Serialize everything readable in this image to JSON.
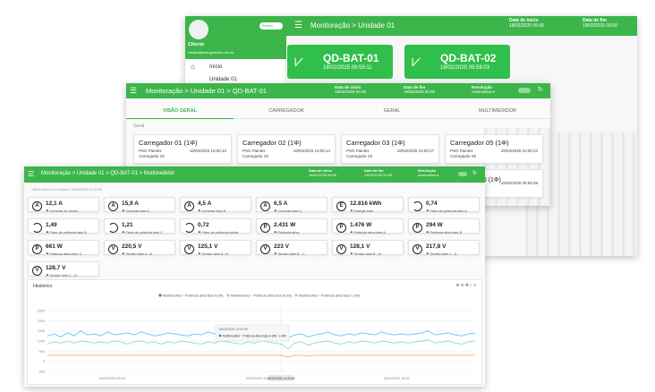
{
  "colors": {
    "brand": "#3cb54a",
    "card": "#2fbf4a",
    "current_a": "#2f7fd6",
    "power_a": "#56c8ea",
    "power_b": "#8adfb0",
    "power_c": "#f2b37a"
  },
  "win1": {
    "sidebar": {
      "user_name": "Cliente",
      "user_email": "cliente@energytrader.com.br",
      "switch_label": "Switch",
      "items": [
        {
          "label": "Início"
        },
        {
          "label": "Unidade 01"
        }
      ]
    },
    "header": {
      "title": "Monitoração > Unidade 01",
      "date_start_label": "Data de início",
      "date_start": "18/02/2025 06:00",
      "date_end_label": "Data de fim",
      "date_end": "19/02/2025 00:00"
    },
    "cards": [
      {
        "name": "QD-BAT-01",
        "date": "18/02/2025 09:59:11"
      },
      {
        "name": "QD-BAT-02",
        "date": "18/02/2025 09:59:03"
      }
    ]
  },
  "win2": {
    "header": {
      "title": "Monitoração > Unidade 01 > QD-BAT-01",
      "date_start_label": "Data de início",
      "date_start": "18/02/2025 06:00",
      "date_end_label": "Data de fim",
      "date_end": "19/02/2025 00:00",
      "resolution_label": "Resolução",
      "resolution": "Automática"
    },
    "tabs": [
      {
        "label": "VISÃO GERAL"
      },
      {
        "label": "CARREGADOR"
      },
      {
        "label": "GERAL"
      },
      {
        "label": "MULTIMEDIDOR"
      }
    ],
    "section_label": "Geral",
    "chargers": [
      {
        "title": "Carregador 01 (1Φ)",
        "line1": "PSO Painéis",
        "line2": "Carregador 01",
        "date": "18/02/2025 10:00:12"
      },
      {
        "title": "Carregador 02 (1Φ)",
        "line1": "PSO Painéis",
        "line2": "Carregador 02",
        "date": "18/02/2025 10:00:14"
      },
      {
        "title": "Carregador 03 (1Φ)",
        "line1": "PSO Painéis",
        "line2": "Carregador 03",
        "date": "18/02/2025 10:00:17"
      },
      {
        "title": "Carregador 05 (1Φ)",
        "line1": "PSO Painéis",
        "line2": "Carregador 05",
        "date": "18/02/2025 10:00:23"
      }
    ],
    "extra": {
      "title": "10 (1Φ)",
      "date": "18/02/2025 09:59:38"
    }
  },
  "win3": {
    "header": {
      "title": "Monitoração > Unidade 01 > QD-BAT-01 > Multimedidor",
      "date_start_label": "Data de início",
      "date_start": "18/02/2025 06:00",
      "date_end_label": "Data de fim",
      "date_end": "19/02/2025 00:00",
      "resolution_label": "Resolução",
      "resolution": "Automática"
    },
    "last_update": "Última leitura do medidor: 18/02/2025 11:02:00",
    "metrics": [
      {
        "icon": "A",
        "value": "12,1 A",
        "label": "Corrente de neutro"
      },
      {
        "icon": "A",
        "value": "15,9 A",
        "label": "Corrente fase A"
      },
      {
        "icon": "A",
        "value": "4,5 A",
        "label": "Corrente fase B"
      },
      {
        "icon": "A",
        "value": "6,5 A",
        "label": "Corrente fase C"
      },
      {
        "icon": "E",
        "value": "12.816 kWh",
        "label": "Energia total"
      },
      {
        "icon": "pf",
        "value": "0,74",
        "label": "Fator de potência fase A"
      },
      {
        "icon": "pf",
        "value": "1,49",
        "label": "Fator de potência fase B"
      },
      {
        "icon": "pf",
        "value": "1,21",
        "label": "Fator de potência fase C"
      },
      {
        "icon": "pf",
        "value": "0,72",
        "label": "Fator de potência médio"
      },
      {
        "icon": "P",
        "value": "2.431 W",
        "label": "Potência ativa"
      },
      {
        "icon": "P",
        "value": "1.476 W",
        "label": "Potência ativa fase A"
      },
      {
        "icon": "P",
        "value": "294 W",
        "label": "Potência ativa fase B"
      },
      {
        "icon": "P",
        "value": "661 W",
        "label": "Potência ativa fase C"
      },
      {
        "icon": "V",
        "value": "220,5 V",
        "label": "Tensão fase A - B"
      },
      {
        "icon": "V",
        "value": "125,1 V",
        "label": "Tensão fase A - N"
      },
      {
        "icon": "V",
        "value": "223 V",
        "label": "Tensão fase B - C"
      },
      {
        "icon": "V",
        "value": "128,1 V",
        "label": "Tensão fase B - N"
      },
      {
        "icon": "V",
        "value": "217,8 V",
        "label": "Tensão fase C - A"
      },
      {
        "icon": "V",
        "value": "128,7 V",
        "label": "Tensão fase C - N"
      }
    ],
    "history": {
      "title": "Histórico",
      "legend": [
        {
          "name": "Multimedidor - Potência ativa fase A (W)",
          "color": "#2f7fd6"
        },
        {
          "name": "Multimedidor - Potência ativa fase B (W)",
          "color": "#8adfb0"
        },
        {
          "name": "Multimedidor - Potência ativa fase C (W)",
          "color": "#f2b37a"
        }
      ],
      "y_ticks": [
        "2500",
        "2000",
        "1500",
        "1000",
        "500",
        "0",
        "-500"
      ],
      "x_ticks": [
        "18/02/2025 06:00",
        "18/02/2025 12:00",
        "18/02/2025 18:00",
        "19/02/2025 00:00"
      ],
      "tooltip": {
        "time": "18/02/2025 14:20:00",
        "series": "Multimedidor - Potência ativa fase A (W): 1.435"
      },
      "cursor_label": "18/02/2025 14:20:00",
      "chart_data": {
        "type": "line",
        "ylim": [
          -500,
          2500
        ],
        "series": [
          {
            "name": "Multimedidor - Potência ativa fase A (W)",
            "values": [
              1250,
              1350,
              1200,
              1400,
              1250,
              1500,
              1300,
              1350,
              1250,
              1450,
              1300,
              1350,
              1400,
              1300,
              1450,
              1350,
              1250,
              1300,
              1400,
              1350,
              1300,
              1250,
              1350,
              1300,
              1450,
              1350,
              1400,
              1300,
              1350,
              1250,
              1300,
              1350,
              1400,
              1300,
              1350,
              1250,
              1150,
              1300,
              1350,
              1200,
              1300,
              1350,
              1450,
              1300,
              1250,
              1350,
              1300,
              1400,
              1350,
              1300,
              1450,
              1350,
              1300,
              1350,
              1300,
              1350,
              1400,
              1500,
              1300,
              1350,
              1400,
              1300,
              1250,
              1350,
              1400
            ]
          },
          {
            "name": "Multimedidor - Potência ativa fase B (W)",
            "values": [
              850,
              950,
              900,
              1000,
              900,
              1000,
              950,
              900,
              950,
              900,
              1000,
              950,
              850,
              950,
              1000,
              900,
              950,
              850,
              950,
              900,
              1000,
              950,
              900,
              850,
              950,
              900,
              1000,
              950,
              900,
              850,
              950,
              900,
              1000,
              950,
              900,
              850,
              600,
              900,
              950,
              800,
              900,
              950,
              1000,
              900,
              850,
              950,
              900,
              1000,
              950,
              900,
              1000,
              950,
              900,
              950,
              900,
              950,
              1000,
              1050,
              900,
              950,
              1000,
              900,
              850,
              950,
              1000
            ]
          },
          {
            "name": "Multimedidor - Potência ativa fase C (W)",
            "values": [
              300,
              300,
              300,
              300,
              300,
              300,
              300,
              300,
              300,
              300,
              300,
              300,
              300,
              300,
              300,
              300,
              300,
              300,
              300,
              300,
              300,
              300,
              300,
              300,
              300,
              300,
              300,
              300,
              300,
              300,
              300,
              300,
              300,
              300,
              300,
              300,
              200,
              300,
              300,
              250,
              300,
              300,
              300,
              300,
              300,
              300,
              300,
              300,
              300,
              300,
              300,
              300,
              300,
              300,
              300,
              300,
              300,
              300,
              300,
              300,
              300,
              300,
              300,
              300,
              300
            ]
          }
        ]
      }
    }
  }
}
